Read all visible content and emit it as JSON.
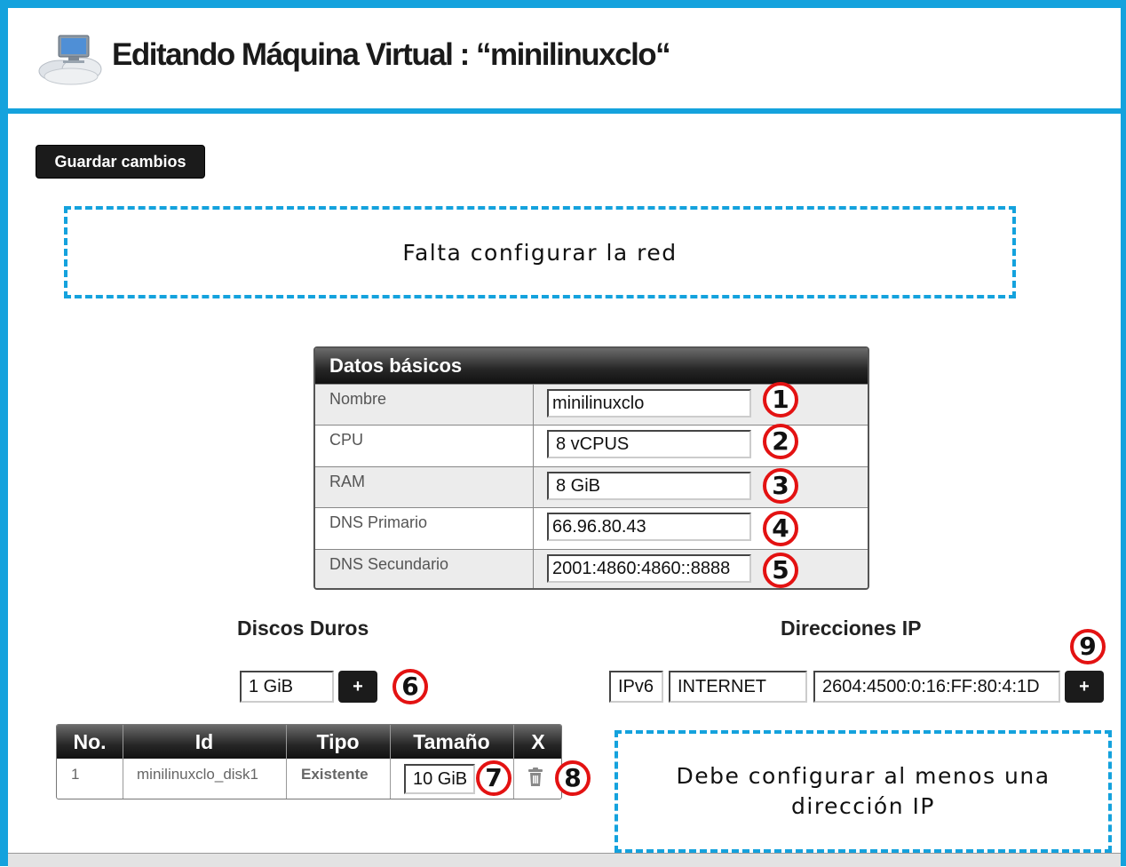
{
  "header": {
    "title": "Editando Máquina Virtual : “minilinuxclo“",
    "logo_icon": "cloud-computer-icon"
  },
  "toolbar": {
    "save_label": "Guardar cambios"
  },
  "warnings": {
    "network": "Falta configurar la red",
    "ip": "Debe configurar al menos una dirección IP"
  },
  "basic": {
    "title": "Datos básicos",
    "rows": [
      {
        "label": "Nombre",
        "value": "minilinuxclo",
        "marker": "1"
      },
      {
        "label": "CPU",
        "value": "8 vCPUS",
        "marker": "2"
      },
      {
        "label": "RAM",
        "value": "8 GiB",
        "marker": "3"
      },
      {
        "label": "DNS Primario",
        "value": "66.96.80.43",
        "marker": "4"
      },
      {
        "label": "DNS Secundario",
        "value": "2001:4860:4860::8888",
        "marker": "5"
      }
    ]
  },
  "disks": {
    "title": "Discos Duros",
    "new_size": "1 GiB",
    "add_label": "+",
    "marker": "6",
    "columns": [
      "No.",
      "Id",
      "Tipo",
      "Tamaño",
      "X"
    ],
    "rows": [
      {
        "no": "1",
        "id": "minilinuxclo_disk1",
        "tipo": "Existente",
        "size": "10 GiB",
        "size_marker": "7",
        "delete_marker": "8"
      }
    ]
  },
  "ips": {
    "title": "Direcciones IP",
    "version": "IPv6",
    "network": "INTERNET",
    "address": "2604:4500:0:16:FF:80:4:1D",
    "add_label": "+",
    "marker": "9"
  },
  "colors": {
    "accent": "#14a2dd",
    "marker": "#e31212",
    "dark": "#1b1b1b"
  }
}
